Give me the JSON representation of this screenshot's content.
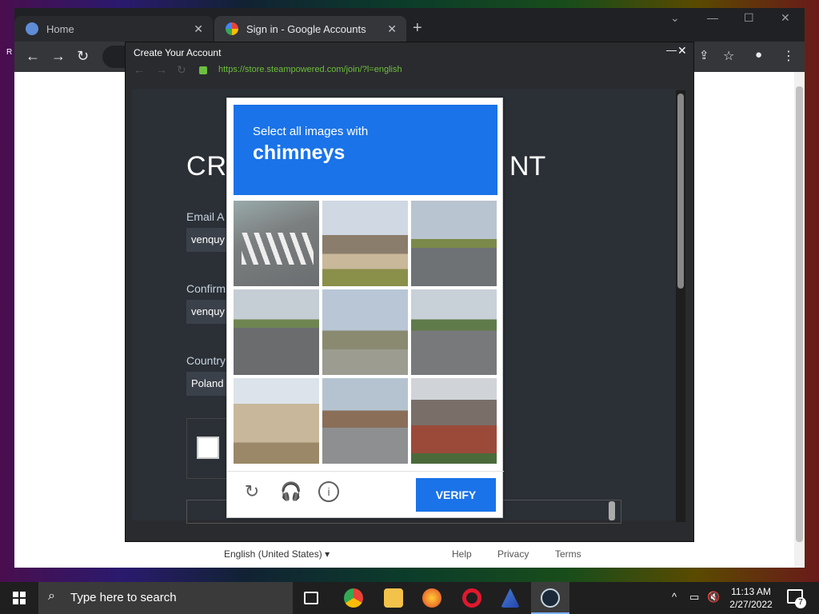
{
  "browser": {
    "tabs": [
      {
        "label": "Home"
      },
      {
        "label": "Sign in - Google Accounts"
      }
    ],
    "footer": {
      "language": "English (United States)",
      "links": [
        "Help",
        "Privacy",
        "Terms"
      ]
    }
  },
  "popup": {
    "title": "Create Your Account",
    "url": "https://store.steampowered.com/join/?l=english",
    "heading_left": "CR",
    "heading_right": "NT",
    "fields": [
      {
        "label": "Email A",
        "value": "venquy"
      },
      {
        "label": "Confirm",
        "value": "venquy"
      },
      {
        "label": "Country",
        "value": "Poland"
      }
    ]
  },
  "captcha": {
    "instruction": "Select all images with",
    "target": "chimneys",
    "verify_label": "VERIFY"
  },
  "taskbar": {
    "search_placeholder": "Type here to search",
    "time": "11:13 AM",
    "date": "2/27/2022",
    "notification_count": "7"
  },
  "colors": {
    "captcha_blue": "#1a73e8",
    "steam_bg": "#2b2f36",
    "url_green": "#6dbf3d"
  }
}
